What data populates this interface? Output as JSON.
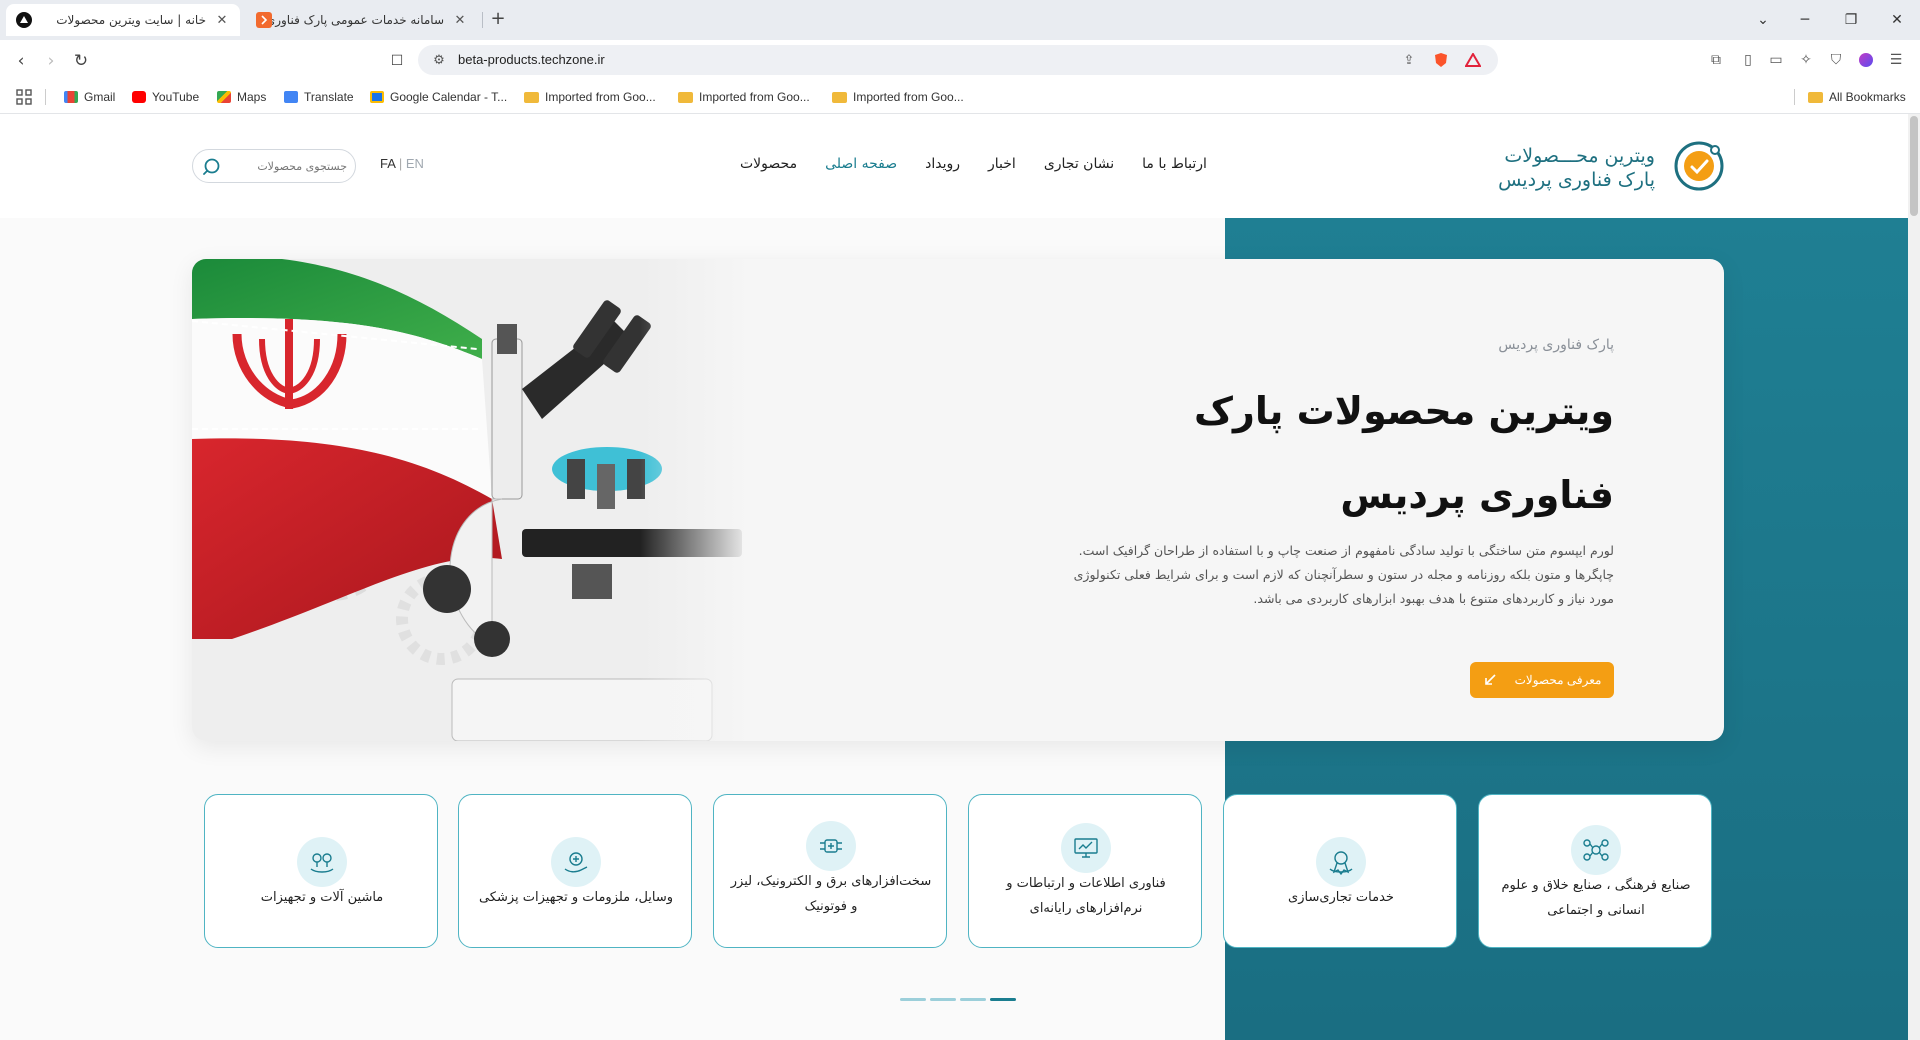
{
  "browser": {
    "tabs": [
      {
        "title": "خانه | سایت ویترین محصولات",
        "active": true,
        "favicon": "brave-logo-icon"
      },
      {
        "title": "سامانه خدمات عمومی پارک فناوری پردیس",
        "active": false,
        "favicon": "site-favicon-icon"
      }
    ],
    "url": "beta-products.techzone.ir",
    "bookmarks": [
      {
        "label": "Gmail",
        "icon": "gmail-icon"
      },
      {
        "label": "YouTube",
        "icon": "youtube-icon"
      },
      {
        "label": "Maps",
        "icon": "maps-icon"
      },
      {
        "label": "Translate",
        "icon": "translate-icon"
      },
      {
        "label": "Google Calendar - T...",
        "icon": "calendar-icon"
      },
      {
        "label": "Imported from Goo...",
        "icon": "folder-icon"
      },
      {
        "label": "Imported from Goo...",
        "icon": "folder-icon"
      },
      {
        "label": "Imported from Goo...",
        "icon": "folder-icon"
      }
    ],
    "all_bookmarks": "All Bookmarks"
  },
  "site": {
    "logo": {
      "line1": "ویترین محـــصولات",
      "line2": "پارک فناوری پردیس"
    },
    "nav": [
      {
        "label": "محصولات",
        "active": false
      },
      {
        "label": "صفحه اصلی",
        "active": true
      },
      {
        "label": "رویداد",
        "active": false
      },
      {
        "label": "اخبار",
        "active": false
      },
      {
        "label": "نشان تجاری",
        "active": false
      },
      {
        "label": "ارتباط با ما",
        "active": false
      }
    ],
    "lang": {
      "fa": "FA",
      "sep": "|",
      "en": "EN"
    },
    "search": {
      "placeholder": "جستجوی محصولات"
    }
  },
  "hero": {
    "subtitle": "پارک فناوری پردیس",
    "title": "ویترین محصولات پارک فناوری پردیس",
    "description": "لورم ایپسوم متن ساختگی با تولید سادگی نامفهوم از صنعت چاپ و با استفاده از طراحان گرافیک است. چاپگرها و متون بلکه روزنامه و مجله در ستون و سطرآنچنان که لازم است و برای شرایط فعلی تکنولوژی مورد نیاز و کاربردهای متنوع با هدف بهبود ابزارهای کاربردی می باشد.",
    "button": "معرفی محصولات"
  },
  "categories": [
    {
      "label": "صنایع فرهنگی ، صنایع خلاق و علوم انسانی و اجتماعی",
      "icon": "molecule-icon"
    },
    {
      "label": "خدمات تجاری‌سازی",
      "icon": "award-icon"
    },
    {
      "label": "فناوری اطلاعات و ارتباطات و نرم‌افزارهای رایانه‌ای",
      "icon": "computer-icon"
    },
    {
      "label": "سخت‌افزارهای برق و الکترونیک، لیزر و فوتونیک",
      "icon": "circuit-icon"
    },
    {
      "label": "وسایل، ملزومات و تجهیزات پزشکی",
      "icon": "medical-hand-icon"
    },
    {
      "label": "ماشین آلات و تجهیزات",
      "icon": "machinery-icon"
    }
  ],
  "carousel": {
    "pages": 4,
    "active_page": 4
  },
  "colors": {
    "teal": "#1f7f93",
    "accent_orange": "#f49e13",
    "active_nav": "#1a7d8f"
  }
}
